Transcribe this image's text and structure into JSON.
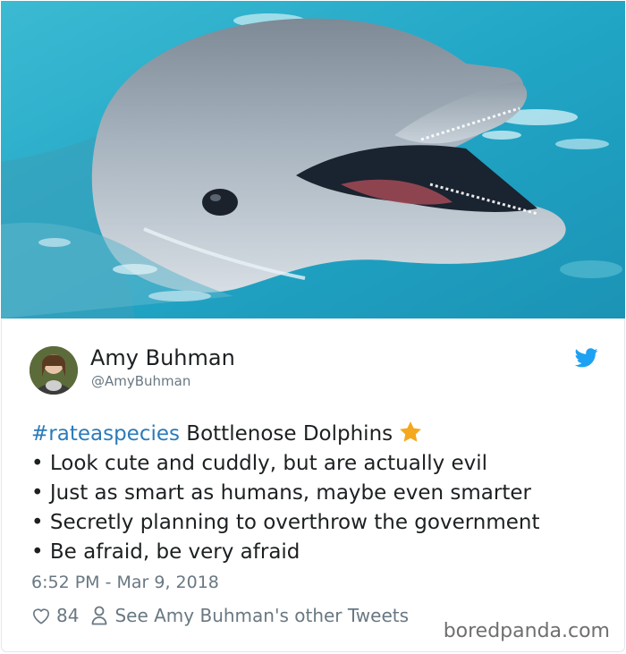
{
  "tweet": {
    "author_name": "Amy Buhman",
    "author_handle": "@AmyBuhman",
    "hashtag": "#rateaspecies",
    "title_text": " Bottlenose Dolphins",
    "bullets": [
      "• Look cute and cuddly, but are actually evil",
      "• Just as smart as humans, maybe even smarter",
      "• Secretly planning to overthrow the government",
      "• Be afraid, be very afraid"
    ],
    "timestamp": "6:52 PM - Mar 9, 2018",
    "like_count": "84",
    "other_tweets_link": "See Amy Buhman's other Tweets"
  },
  "watermark": "boredpanda.com",
  "icons": {
    "brand": "twitter-bird-icon",
    "emoji": "star-icon",
    "like": "heart-icon",
    "profile": "person-icon"
  },
  "colors": {
    "hashtag": "#2b7bb9",
    "twitter_blue": "#1da1f2",
    "star": "#f4a81d",
    "meta_gray": "#697882",
    "water": "#1fa3c3"
  }
}
